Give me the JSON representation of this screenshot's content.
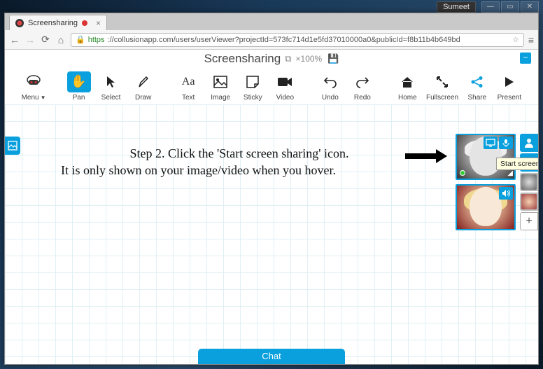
{
  "os_user": "Sumeet",
  "browser": {
    "tab_title": "Screensharing",
    "url_prefix": "https",
    "url_host": "://collusionapp.com",
    "url_path": "/users/userViewer?projectId=573fc714d1e5fd37010000a0&publicId=f8b11b4b649bd"
  },
  "app": {
    "title": "Screensharing",
    "zoom": "×100%"
  },
  "toolbar": {
    "menu": "Menu",
    "pan": "Pan",
    "select": "Select",
    "draw": "Draw",
    "text": "Text",
    "image": "Image",
    "sticky": "Sticky",
    "video": "Video",
    "undo": "Undo",
    "redo": "Redo",
    "home": "Home",
    "fullscreen": "Fullscreen",
    "share": "Share",
    "present": "Present"
  },
  "instruction": {
    "line1": "Step 2. Click the 'Start screen sharing' icon.",
    "line2": "It is only shown on your image/video when you hover."
  },
  "tooltip": "Start screen sharing",
  "chat": "Chat",
  "sidebar": {
    "add": "+"
  }
}
